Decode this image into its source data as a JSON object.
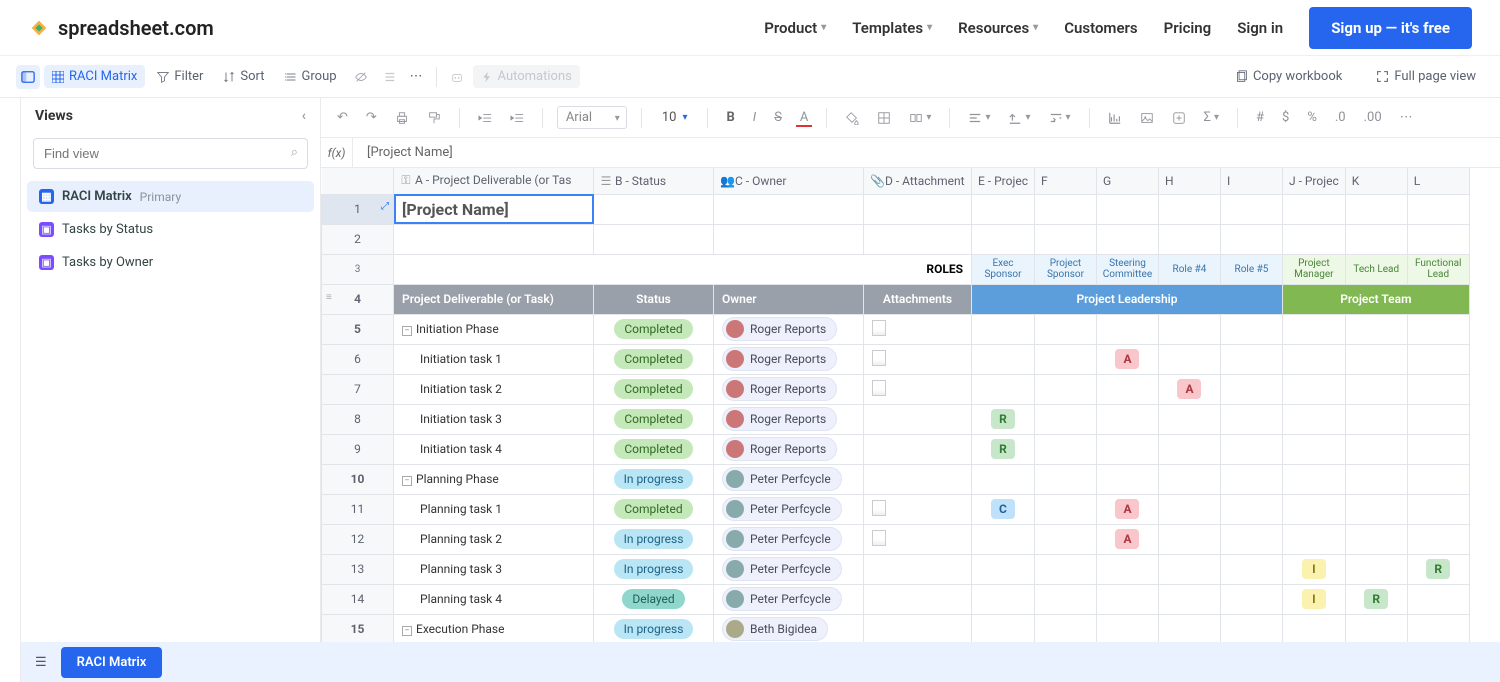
{
  "brand": "spreadsheet.com",
  "nav": {
    "product": "Product",
    "templates": "Templates",
    "resources": "Resources",
    "customers": "Customers",
    "pricing": "Pricing",
    "signin": "Sign in",
    "signup": "Sign up — it's free"
  },
  "toolbar1": {
    "raci": "RACI Matrix",
    "filter": "Filter",
    "sort": "Sort",
    "group": "Group",
    "automations": "Automations",
    "copy": "Copy workbook",
    "fullpage": "Full page view"
  },
  "views": {
    "title": "Views",
    "find_placeholder": "Find view",
    "items": [
      {
        "label": "RACI Matrix",
        "primary": "Primary",
        "icon": "grid"
      },
      {
        "label": "Tasks by Status",
        "icon": "kanban"
      },
      {
        "label": "Tasks by Owner",
        "icon": "kanban"
      }
    ]
  },
  "formatting": {
    "font": "Arial",
    "size": "10"
  },
  "fx": "[Project Name]",
  "columns": [
    {
      "key": "A",
      "label": "A - Project Deliverable (or Tas",
      "icon": "key"
    },
    {
      "key": "B",
      "label": "B - Status",
      "icon": "sel"
    },
    {
      "key": "C",
      "label": "C - Owner",
      "icon": "user"
    },
    {
      "key": "D",
      "label": "D - Attachment",
      "icon": "clip"
    },
    {
      "key": "E",
      "label": "E - Projec"
    },
    {
      "key": "F",
      "label": "F"
    },
    {
      "key": "G",
      "label": "G"
    },
    {
      "key": "H",
      "label": "H"
    },
    {
      "key": "I",
      "label": "I"
    },
    {
      "key": "J",
      "label": "J - Projec"
    },
    {
      "key": "K",
      "label": "K"
    },
    {
      "key": "L",
      "label": "L"
    }
  ],
  "cells": {
    "project_name": "[Project Name]",
    "roles_label": "ROLES",
    "roles": {
      "e": "Exec Sponsor",
      "f": "Project Sponsor",
      "g": "Steering Committee",
      "h": "Role #4",
      "i": "Role #5",
      "j": "Project Manager",
      "k": "Tech Lead",
      "l": "Functional Lead"
    },
    "band": {
      "a": "Project Deliverable (or Task)",
      "b": "Status",
      "c": "Owner",
      "d": "Attachments",
      "leadership": "Project Leadership",
      "team": "Project Team"
    }
  },
  "rows": [
    {
      "n": 5,
      "phase": true,
      "task": "Initiation Phase",
      "status": "Completed",
      "status_c": "completed",
      "owner": "Roger Reports",
      "owner_a": "",
      "attach": true
    },
    {
      "n": 6,
      "task": "Initiation task 1",
      "status": "Completed",
      "status_c": "completed",
      "owner": "Roger Reports",
      "attach": true,
      "raci": {
        "g": "A"
      }
    },
    {
      "n": 7,
      "task": "Initiation task 2",
      "status": "Completed",
      "status_c": "completed",
      "owner": "Roger Reports",
      "attach": true,
      "raci": {
        "h": "A"
      }
    },
    {
      "n": 8,
      "task": "Initiation task 3",
      "status": "Completed",
      "status_c": "completed",
      "owner": "Roger Reports",
      "raci": {
        "e": "R"
      }
    },
    {
      "n": 9,
      "task": "Initiation task 4",
      "status": "Completed",
      "status_c": "completed",
      "owner": "Roger Reports",
      "raci": {
        "e": "R"
      }
    },
    {
      "n": 10,
      "phase": true,
      "task": "Planning Phase",
      "status": "In progress",
      "status_c": "inprogress",
      "owner": "Peter Perfcycle",
      "owner_a": "p"
    },
    {
      "n": 11,
      "task": "Planning task 1",
      "status": "Completed",
      "status_c": "completed",
      "owner": "Peter Perfcycle",
      "owner_a": "p",
      "attach": true,
      "raci": {
        "e": "C",
        "g": "A"
      }
    },
    {
      "n": 12,
      "task": "Planning task 2",
      "status": "In progress",
      "status_c": "inprogress",
      "owner": "Peter Perfcycle",
      "owner_a": "p",
      "attach": true,
      "raci": {
        "g": "A"
      }
    },
    {
      "n": 13,
      "task": "Planning task 3",
      "status": "In progress",
      "status_c": "inprogress",
      "owner": "Peter Perfcycle",
      "owner_a": "p",
      "raci": {
        "j": "I",
        "l": "R"
      }
    },
    {
      "n": 14,
      "task": "Planning task 4",
      "status": "Delayed",
      "status_c": "delayed",
      "owner": "Peter Perfcycle",
      "owner_a": "p",
      "raci": {
        "j": "I",
        "k": "R"
      }
    },
    {
      "n": 15,
      "phase": true,
      "task": "Execution Phase",
      "status": "In progress",
      "status_c": "inprogress",
      "owner": "Beth Bigidea",
      "owner_a": "b"
    }
  ],
  "bottom_tab": "RACI Matrix"
}
